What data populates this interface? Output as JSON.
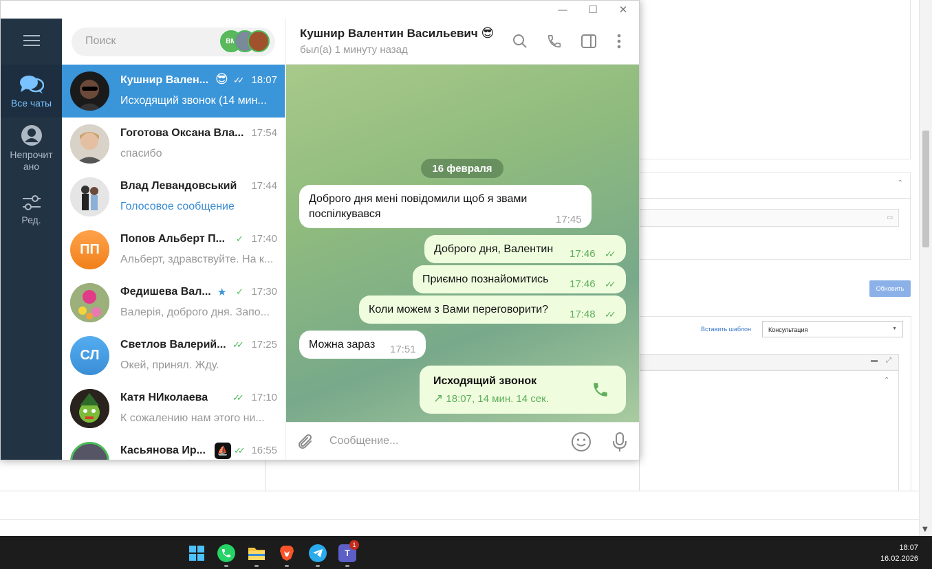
{
  "window": {
    "controls": {
      "minimize": "—",
      "maximize": "☐",
      "close": "✕"
    }
  },
  "rail": {
    "items": [
      {
        "label": "Все чаты",
        "icon": "chats-icon",
        "active": true
      },
      {
        "label": "Непрочит ано",
        "icon": "user-circle-icon",
        "active": false
      },
      {
        "label": "Ред.",
        "icon": "sliders-icon",
        "active": false
      }
    ]
  },
  "search": {
    "placeholder": "Поиск",
    "stories": [
      "ВМ",
      "",
      ""
    ]
  },
  "chats": [
    {
      "name": "Кушнир Вален...",
      "time": "18:07",
      "preview": "Исходящий звонок (14 мин...",
      "ticks": "✓✓",
      "selected": true,
      "badge_icon": "sunglasses-emoji-icon"
    },
    {
      "name": "Гоготова Оксана Вла...",
      "time": "17:54",
      "preview": "спасибо",
      "ticks": "",
      "selected": false
    },
    {
      "name": "Влад Левандовський",
      "time": "17:44",
      "preview": "Голосовое сообщение",
      "ticks": "",
      "selected": false
    },
    {
      "name": "Попов Альберт П...",
      "time": "17:40",
      "preview": "Альберт, здравствуйте. На к...",
      "ticks": "✓",
      "selected": false,
      "initials": "ПП",
      "color": "#f7912d"
    },
    {
      "name": "Федишева Вал...",
      "time": "17:30",
      "preview": "Валерія, доброго дня. Запо...",
      "ticks": "✓",
      "selected": false,
      "star": "★"
    },
    {
      "name": "Светлов Валерий...",
      "time": "17:25",
      "preview": "Окей, принял. Жду.",
      "ticks": "✓✓",
      "selected": false,
      "initials": "СЛ",
      "color": "#3a95d9"
    },
    {
      "name": "Катя НИколаева",
      "time": "17:10",
      "preview": "К сожалению нам этого ни...",
      "ticks": "✓✓",
      "selected": false
    },
    {
      "name": "Касьянова Ир...",
      "time": "16:55",
      "preview": "",
      "ticks": "✓✓",
      "selected": false
    }
  ],
  "header": {
    "title": "Кушнир Валентин Васильевич",
    "status": "был(а) 1 минуту назад",
    "icons": [
      "search-icon",
      "phone-icon",
      "sidebar-toggle-icon",
      "more-vertical-icon"
    ]
  },
  "conversation": {
    "date": "16 февраля",
    "messages": [
      {
        "dir": "in",
        "text": "Доброго дня мені повідомили щоб я звами поспілкувався",
        "time": "17:45"
      },
      {
        "dir": "out",
        "text": "Доброго дня, Валентин",
        "time": "17:46",
        "ticks": "✓✓"
      },
      {
        "dir": "out",
        "text": "Приємно познайомитись",
        "time": "17:46",
        "ticks": "✓✓"
      },
      {
        "dir": "out",
        "text": "Коли можем з Вами переговорити?",
        "time": "17:48",
        "ticks": "✓✓"
      },
      {
        "dir": "in",
        "text": "Можна зараз",
        "time": "17:51"
      }
    ],
    "call": {
      "title": "Исходящий звонок",
      "detail": "18:07, 14 мин. 14 сек.",
      "arrow": "↗"
    }
  },
  "composer": {
    "placeholder": "Сообщение..."
  },
  "background_app": {
    "template_link": "Вставить шаблон",
    "select_value": "Консультация",
    "refresh_button": "Обновить"
  },
  "taskbar": {
    "time": "18:07",
    "date": "16.02.2026",
    "apps": [
      "windows-start-icon",
      "whatsapp-icon",
      "file-explorer-icon",
      "brave-icon",
      "telegram-icon",
      "teams-icon"
    ],
    "teams_badge": "1"
  }
}
